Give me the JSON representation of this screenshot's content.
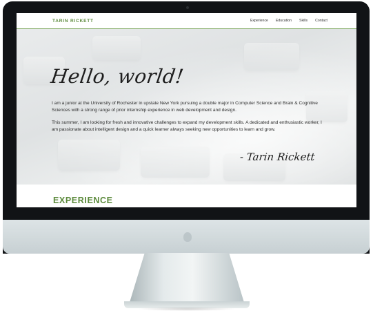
{
  "nav": {
    "brand": "TARIN RICKETT",
    "links": [
      "Experience",
      "Education",
      "Skills",
      "Contact"
    ]
  },
  "hero": {
    "heading": "Hello, world!",
    "paragraph1": "I am a junior at the University of Rochester in upstate New York pursuing a double major in Computer Science and Brain & Cognitive Sciences with a strong range of prior internship experience in web development and design.",
    "paragraph2": "This summer, I am looking for fresh and innovative challenges to expand my development skills. A dedicated and enthusiastic worker, I am passionate about intelligent design and a quick learner always seeking new opportunities to learn and grow.",
    "signature": "- Tarin Rickett"
  },
  "section": {
    "title": "EXPERIENCE"
  },
  "colors": {
    "accent": "#5c8a3c",
    "bezel": "#111316"
  },
  "icons": {
    "apple_logo": "apple-logo-icon"
  }
}
